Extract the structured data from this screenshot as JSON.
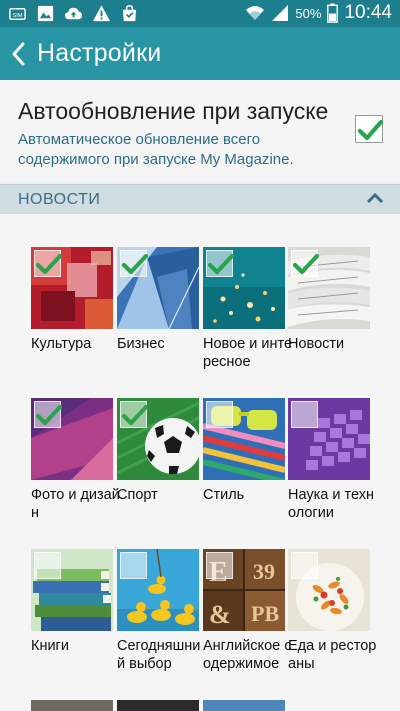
{
  "status_bar": {
    "icons": [
      "sim-icon",
      "image-icon",
      "cloud-upload-icon",
      "warning-icon",
      "bag-icon"
    ],
    "battery_percent": "50%",
    "time": "10:44"
  },
  "app_bar": {
    "title": "Настройки"
  },
  "auto_update": {
    "title": "Автообновление при запуске",
    "description": "Автоматическое обновление всего содержимого при запуске My Magazine.",
    "checked": true
  },
  "section": {
    "title": "НОВОСТИ"
  },
  "categories": [
    {
      "label": "Культура",
      "checked": true,
      "image": "red-painting"
    },
    {
      "label": "Бизнес",
      "checked": true,
      "image": "blue-glass-building"
    },
    {
      "label": "Новое и интересное",
      "checked": true,
      "image": "teal-lights"
    },
    {
      "label": "Новости",
      "checked": true,
      "image": "newspapers"
    },
    {
      "label": "Фото и дизайн",
      "checked": true,
      "image": "purple-pink-abstract"
    },
    {
      "label": "Спорт",
      "checked": true,
      "image": "soccer-ball"
    },
    {
      "label": "Стиль",
      "checked": false,
      "image": "sunglasses"
    },
    {
      "label": "Наука и технологии",
      "checked": false,
      "image": "purple-keyboard"
    },
    {
      "label": "Книги",
      "checked": false,
      "image": "book-stack"
    },
    {
      "label": "Сегодняшний выбор",
      "checked": false,
      "image": "rubber-ducks"
    },
    {
      "label": "Английское содержимое",
      "checked": false,
      "image": "letterpress-type"
    },
    {
      "label": "Еда и рестораны",
      "checked": false,
      "image": "pasta-dish"
    }
  ]
}
